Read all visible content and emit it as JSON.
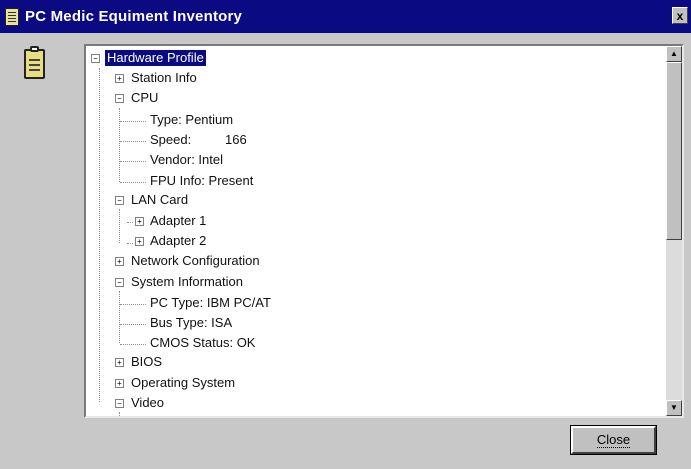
{
  "window": {
    "title": "PC Medic Equiment Inventory",
    "close_glyph": "x"
  },
  "tree": {
    "nodes": [
      {
        "label": "Hardware Profile",
        "expander": "−",
        "selected": true
      },
      {
        "label": "Station Info",
        "expander": "+"
      },
      {
        "label": "CPU",
        "expander": "−"
      },
      {
        "label": "Type: Pentium"
      },
      {
        "label": "Speed:",
        "value": "166"
      },
      {
        "label": "Vendor: Intel"
      },
      {
        "label": "FPU Info: Present"
      },
      {
        "label": "LAN Card",
        "expander": "−"
      },
      {
        "label": "Adapter 1",
        "expander": "+"
      },
      {
        "label": "Adapter 2",
        "expander": "+"
      },
      {
        "label": "Network Configuration",
        "expander": "+"
      },
      {
        "label": "System Information",
        "expander": "−"
      },
      {
        "label": "PC Type: IBM PC/AT"
      },
      {
        "label": "Bus Type: ISA"
      },
      {
        "label": "CMOS Status: OK"
      },
      {
        "label": "BIOS",
        "expander": "+"
      },
      {
        "label": "Operating System",
        "expander": "+"
      },
      {
        "label": "Video",
        "expander": "−"
      }
    ]
  },
  "scrollbar": {
    "up_glyph": "▲",
    "down_glyph": "▼"
  },
  "buttons": {
    "close_label": "Close"
  },
  "colors": {
    "titlebar": "#0a0a82",
    "selection": "#0a0a82",
    "face": "#c0c0c0"
  }
}
